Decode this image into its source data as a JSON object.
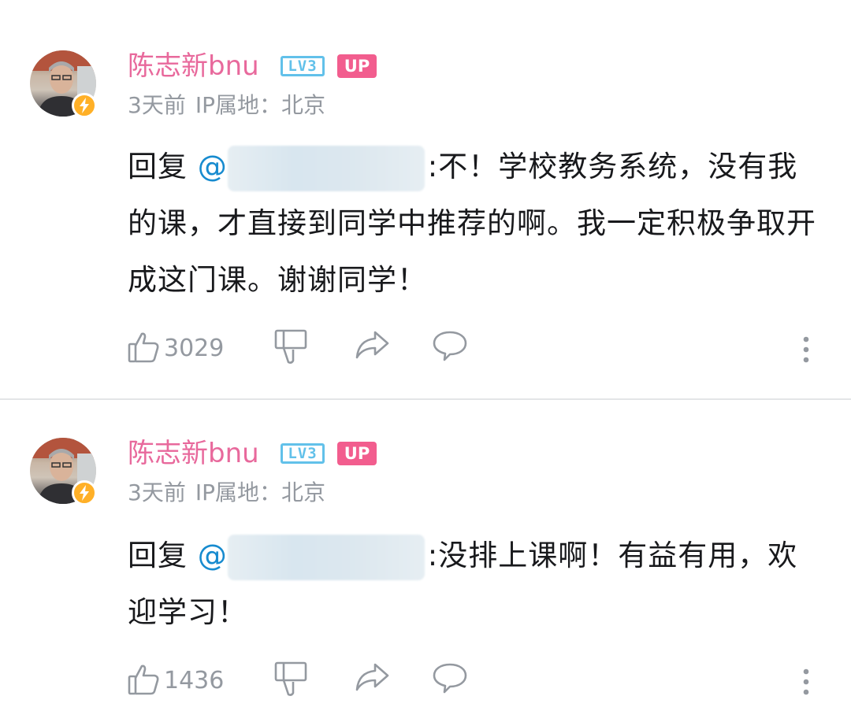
{
  "comments": [
    {
      "username": "陈志新bnu",
      "level_badge": "LV3",
      "up_badge": "UP",
      "time": "3天前",
      "ip": "IP属地：北京",
      "reply_prefix": "回复 ",
      "mention": "@",
      "text": ":不！学校教务系统，没有我的课，才直接到同学中推荐的啊。我一定积极争取开成这门课。谢谢同学！",
      "like_count": "3029"
    },
    {
      "username": "陈志新bnu",
      "level_badge": "LV3",
      "up_badge": "UP",
      "time": "3天前",
      "ip": "IP属地：北京",
      "reply_prefix": "回复 ",
      "mention": "@",
      "text": ":没排上课啊！有益有用，欢迎学习！",
      "like_count": "1436"
    }
  ],
  "icons": {
    "like": "thumbs-up-icon",
    "dislike": "thumbs-down-icon",
    "share": "share-icon",
    "reply": "comment-icon",
    "more": "more-vertical-icon",
    "badge": "lightning-icon"
  },
  "colors": {
    "username": "#e8699c",
    "level": "#62c1ea",
    "up": "#f25d8e",
    "mention": "#178bcf",
    "meta": "#9499a0"
  }
}
